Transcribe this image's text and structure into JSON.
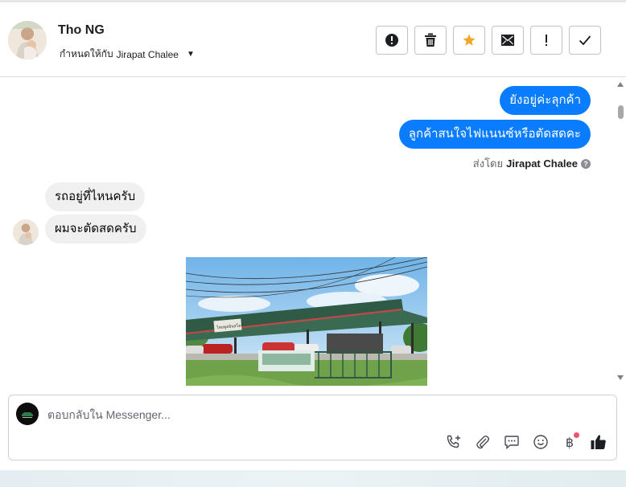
{
  "header": {
    "contact_name": "Tho NG",
    "assign_prefix": "กำหนดให้กับ",
    "assignee": "Jirapat Chalee",
    "actions": [
      {
        "name": "spam-button",
        "icon": "alert-circle-icon"
      },
      {
        "name": "delete-button",
        "icon": "trash-icon"
      },
      {
        "name": "star-button",
        "icon": "star-icon",
        "color": "#f5a623"
      },
      {
        "name": "mark-unread-button",
        "icon": "envelope-icon"
      },
      {
        "name": "follow-up-button",
        "icon": "exclamation-icon"
      },
      {
        "name": "mark-done-button",
        "icon": "check-icon"
      }
    ]
  },
  "conversation": {
    "outgoing": [
      "ยังอยู่ค่ะลุกค้า",
      "ลูกค้าสนใจไฟแนนซ์หรือตัดสดคะ"
    ],
    "sent_by_prefix": "ส่งโดย",
    "sent_by_name": "Jirapat Chalee",
    "incoming": [
      "รถอยู่ที่ไหนครับ",
      "ผมจะตัดสดครับ"
    ],
    "photo_sign_text": "ไทยพูลอินสโตร์"
  },
  "composer": {
    "placeholder": "ตอบกลับใน Messenger...",
    "tools": [
      "phone-plus-icon",
      "paperclip-icon",
      "chat-bubble-icon",
      "emoji-icon",
      "baht-icon",
      "thumbs-up-icon"
    ],
    "baht_symbol": "฿"
  },
  "colors": {
    "outgoing_bubble": "#0a7cff",
    "incoming_bubble": "#f0f0f0",
    "star": "#f5a623",
    "notification_dot": "#f25268"
  }
}
